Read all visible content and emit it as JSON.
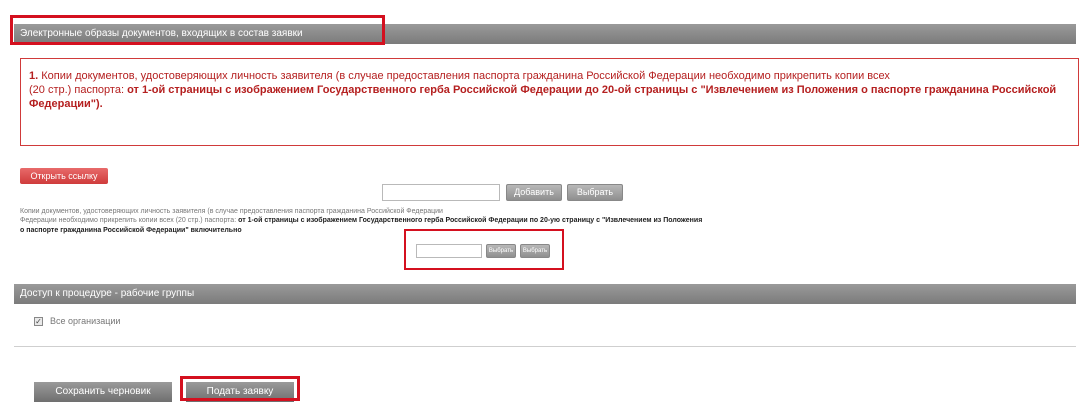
{
  "sections": {
    "documents_title": "Электронные образы документов, входящих в состав заявки",
    "access_title": "Доступ к процедуре - рабочие группы"
  },
  "notice": {
    "number": "1.",
    "text_normal": " Копии документов, удостоверяющих личность заявителя (в случае предоставления паспорта гражданина Российской Федерации необходимо прикрепить копии всех",
    "text_line2_prefix": "(20 стр.) паспорта: ",
    "text_bold": "от 1-ой страницы с изображением Государственного герба Российской Федерации до 20-ой страницы с \"Извлечением из Положения о паспорте гражданина Российской Федерации\")."
  },
  "buttons": {
    "show_link": "Открыть ссылку",
    "add": "Добавить",
    "choose": "Выбрать",
    "small_add": "Выбрать",
    "small_choose": "Выбрать",
    "save_draft": "Сохранить черновик",
    "submit": "Подать заявку"
  },
  "upload_hint": {
    "line1": "Копии документов, удостоверяющих личность заявителя (в случае предоставления паспорта гражданина Российской Федерации",
    "line2_prefix": "Федерации необходимо прикрепить копии всех (20 стр.) паспорта: ",
    "line2_bold": "от 1-ой страницы с изображением Государственного герба Российской Федерации по 20-ую страницу с \"Извлечением из Положения",
    "line3_bold": "о паспорте гражданина Российской Федерации\" включительно"
  },
  "access": {
    "checkbox_label": "Все организации",
    "checked": true
  },
  "colors": {
    "highlight": "#d4101f",
    "section_bar": "#8a8a8a",
    "notice_red": "#b52020"
  }
}
